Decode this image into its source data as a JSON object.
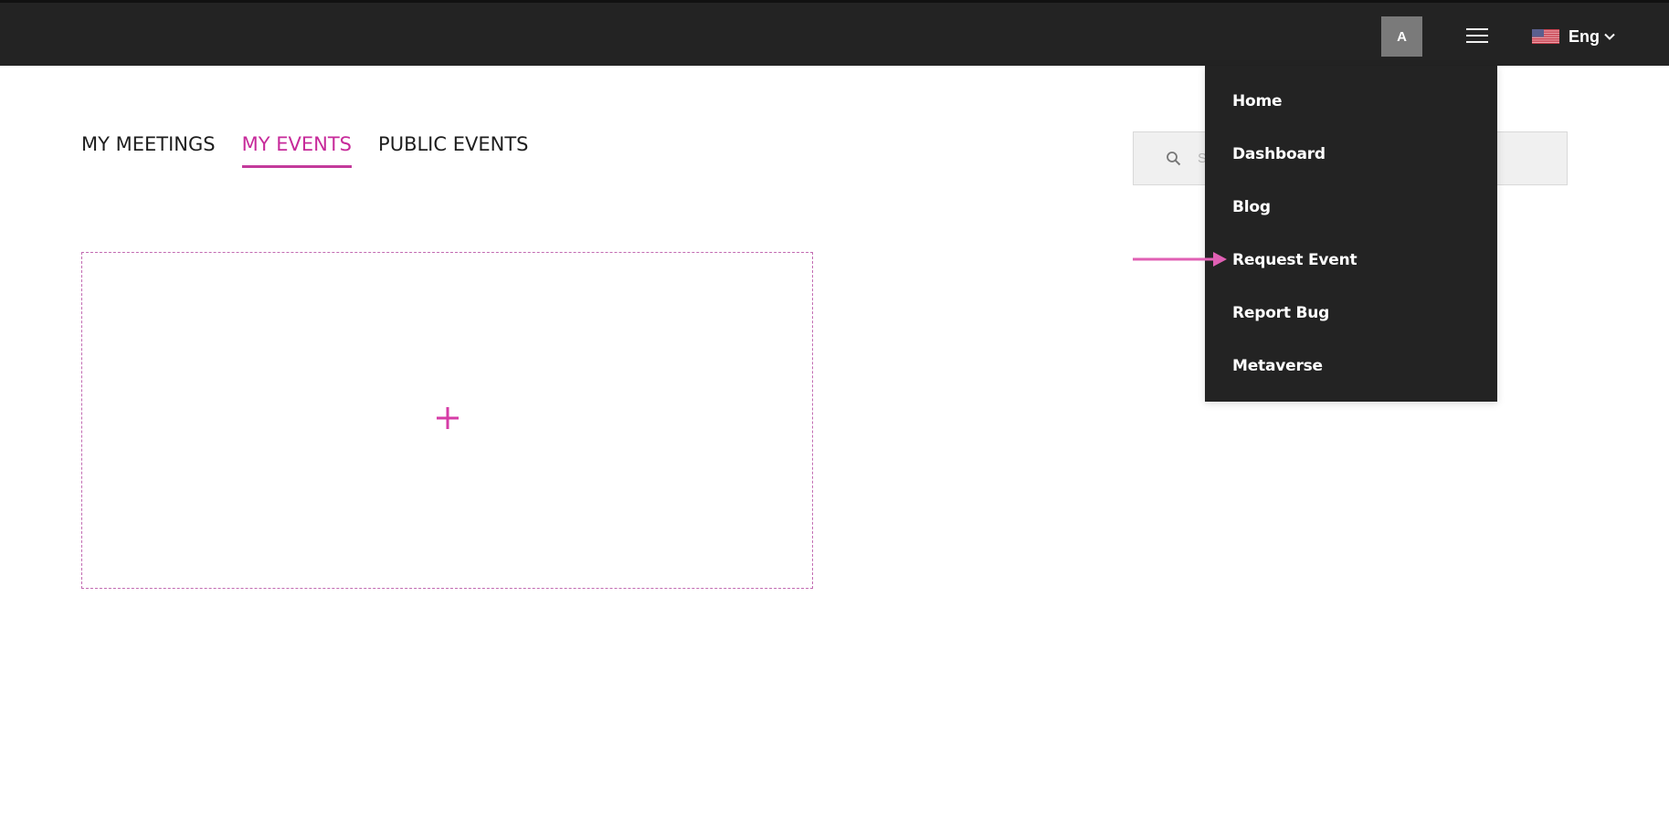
{
  "header": {
    "avatar_initial": "A",
    "menu_icon": "hamburger-menu-icon",
    "language": {
      "flag": "us-flag-icon",
      "label": "Eng",
      "chevron": "chevron-down-icon"
    }
  },
  "tabs": [
    {
      "label": "MY MEETINGS",
      "active": false
    },
    {
      "label": "MY EVENTS",
      "active": true
    },
    {
      "label": "PUBLIC EVENTS",
      "active": false
    }
  ],
  "search": {
    "icon": "search-icon",
    "placeholder": "Search",
    "value": ""
  },
  "event_card": {
    "icon": "plus-icon"
  },
  "dropdown_menu": {
    "items": [
      {
        "label": "Home"
      },
      {
        "label": "Dashboard"
      },
      {
        "label": "Blog"
      },
      {
        "label": "Request Event",
        "highlighted_by_arrow": true
      },
      {
        "label": "Report Bug"
      },
      {
        "label": "Metaverse"
      }
    ]
  },
  "colors": {
    "header_bg": "#232323",
    "accent": "#c72a9a",
    "arrow": "#e060b4",
    "avatar_bg": "#7a7a7a",
    "search_bg": "#f0f0f0"
  }
}
